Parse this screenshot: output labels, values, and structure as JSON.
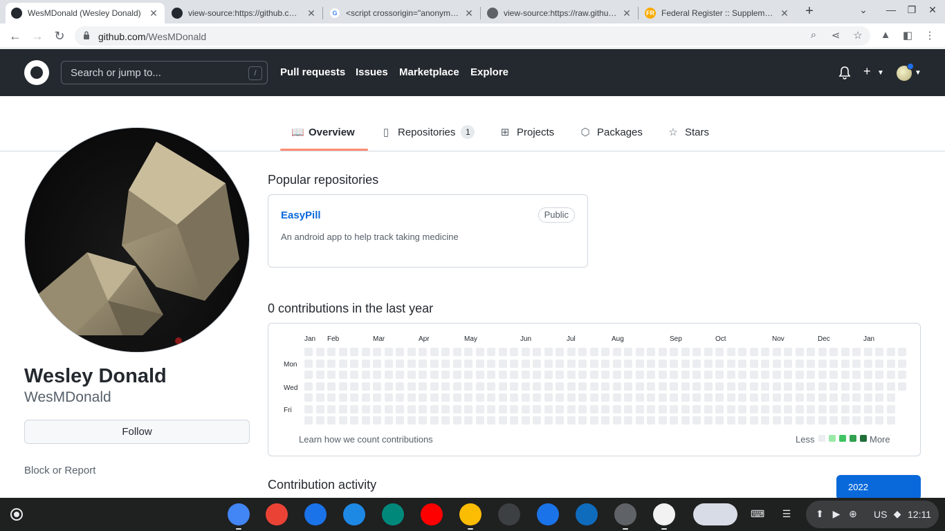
{
  "browser": {
    "tabs": [
      {
        "title": "WesMDonald (Wesley Donald)",
        "favicon": "github-icon",
        "color": "#24292f",
        "glyph": "",
        "active": true
      },
      {
        "title": "view-source:https://github.com/",
        "favicon": "github-icon",
        "color": "#24292f",
        "glyph": ""
      },
      {
        "title": "<script crossorigin=\"anonymous\"",
        "favicon": "google-icon",
        "color": "#4285f4",
        "glyph": "G"
      },
      {
        "title": "view-source:https://raw.githubuser",
        "favicon": "globe-icon",
        "color": "#5f6368",
        "glyph": ""
      },
      {
        "title": "Federal Register :: Supplementary",
        "favicon": "fr-icon",
        "color": "#f9ab00",
        "glyph": "FR"
      }
    ],
    "url_host": "github.com",
    "url_path": "/WesMDonald"
  },
  "github": {
    "search_placeholder": "Search or jump to...",
    "search_shortcut": "/",
    "nav": [
      "Pull requests",
      "Issues",
      "Marketplace",
      "Explore"
    ]
  },
  "profile_tabs": {
    "overview": "Overview",
    "repositories": "Repositories",
    "repositories_count": "1",
    "projects": "Projects",
    "packages": "Packages",
    "stars": "Stars"
  },
  "profile": {
    "full_name": "Wesley Donald",
    "username": "WesMDonald",
    "follow_label": "Follow",
    "block_label": "Block or Report"
  },
  "popular": {
    "title": "Popular repositories",
    "repo_name": "EasyPill",
    "repo_visibility": "Public",
    "repo_description": "An android app to help track taking medicine"
  },
  "contributions": {
    "title": "0 contributions in the last year",
    "months": [
      "Jan",
      "Feb",
      "Mar",
      "Apr",
      "May",
      "Jun",
      "Jul",
      "Aug",
      "Sep",
      "Oct",
      "Nov",
      "Dec",
      "Jan"
    ],
    "weekdays": [
      "Mon",
      "Wed",
      "Fri"
    ],
    "learn_link": "Learn how we count contributions",
    "legend_less": "Less",
    "legend_more": "More",
    "legend_colors": [
      "#ebedf0",
      "#9be9a8",
      "#40c463",
      "#30a14e",
      "#216e39"
    ],
    "total": 0
  },
  "activity": {
    "title": "Contribution activity",
    "year": "2022"
  },
  "shelf": {
    "apps": [
      {
        "name": "chrome-icon",
        "color": "#4285f4"
      },
      {
        "name": "gmail-icon",
        "color": "#ea4335"
      },
      {
        "name": "calendar-icon",
        "color": "#1a73e8"
      },
      {
        "name": "files-icon",
        "color": "#1e88e5"
      },
      {
        "name": "meet-icon",
        "color": "#00897b"
      },
      {
        "name": "youtube-icon",
        "color": "#ff0000"
      },
      {
        "name": "drive-icon",
        "color": "#fbbc04"
      },
      {
        "name": "terminal-icon",
        "color": "#3c4043"
      },
      {
        "name": "messages-icon",
        "color": "#1a73e8"
      },
      {
        "name": "acrobat-icon",
        "color": "#0f6cbd"
      },
      {
        "name": "settings-icon",
        "color": "#5f6368"
      },
      {
        "name": "sql-icon",
        "color": "#f2f2f2"
      }
    ],
    "locale": "US",
    "time": "12:11"
  }
}
